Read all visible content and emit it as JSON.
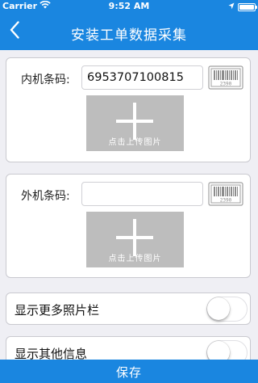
{
  "status_bar": {
    "carrier": "Carrier",
    "time": "9:52 AM",
    "battery_level": 1.0
  },
  "nav": {
    "back_icon": "chevron-left-icon",
    "title": "安装工单数据采集"
  },
  "indoor": {
    "label": "内机条码:",
    "value": "6953707100815",
    "barcode_icon_text": "2390",
    "photo_label": "点击上传图片"
  },
  "outdoor": {
    "label": "外机条码:",
    "value": "",
    "barcode_icon_text": "2390",
    "photo_label": "点击上传图片"
  },
  "toggles": [
    {
      "label": "显示更多照片栏",
      "on": false
    },
    {
      "label": "显示其他信息",
      "on": false
    }
  ],
  "save_label": "保存",
  "colors": {
    "primary": "#1a86e0",
    "background": "#efeff4",
    "photo_placeholder": "#bdbdbd"
  }
}
